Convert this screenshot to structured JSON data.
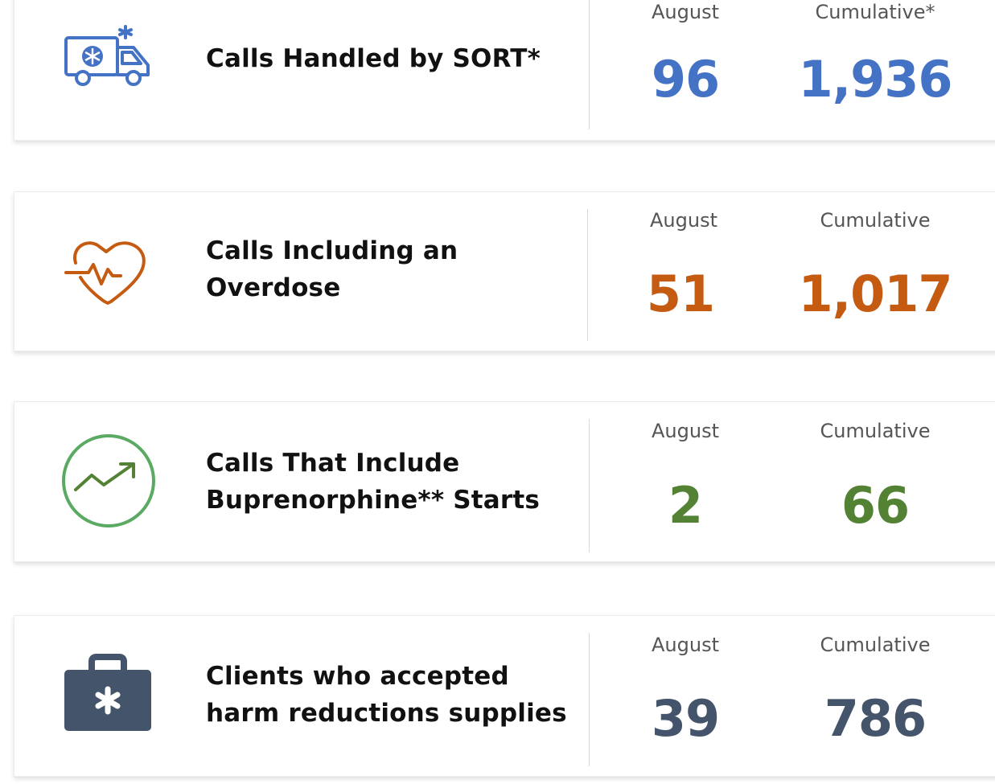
{
  "stats": [
    {
      "icon": "ambulance-icon",
      "color": "#4472C4",
      "label_line1": "Calls Handled by SORT*",
      "label_line2": "",
      "month_header": "August",
      "cumulative_header": "Cumulative*",
      "month_value": "96",
      "cumulative_value": "1,936"
    },
    {
      "icon": "heartbeat-icon",
      "color": "#C55A11",
      "label_line1": "Calls Including an",
      "label_line2": "Overdose",
      "month_header": "August",
      "cumulative_header": "Cumulative",
      "month_value": "51",
      "cumulative_value": "1,017"
    },
    {
      "icon": "trending-up-icon",
      "color": "#548235",
      "label_line1": "Calls That Include",
      "label_line2": "Buprenorphine** Starts",
      "month_header": "August",
      "cumulative_header": "Cumulative",
      "month_value": "2",
      "cumulative_value": "66"
    },
    {
      "icon": "medical-kit-icon",
      "color": "#44546A",
      "label_line1": "Clients who accepted",
      "label_line2": "harm reductions supplies",
      "month_header": "August",
      "cumulative_header": "Cumulative",
      "month_value": "39",
      "cumulative_value": "786"
    }
  ]
}
